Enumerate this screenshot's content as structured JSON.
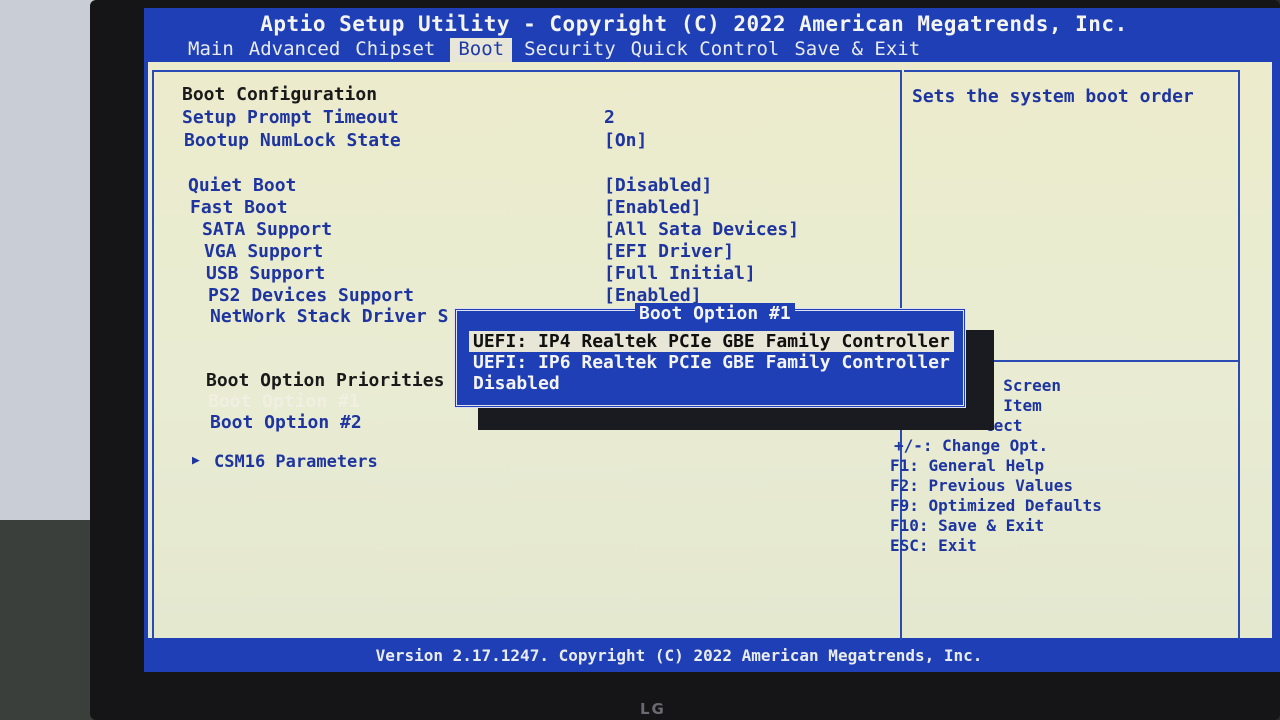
{
  "header": {
    "title": "Aptio Setup Utility - Copyright (C) 2022 American Megatrends, Inc.",
    "tabs": [
      "Main",
      "Advanced",
      "Chipset",
      "Boot",
      "Security",
      "Quick Control",
      "Save & Exit"
    ],
    "active_tab": "Boot"
  },
  "settings": {
    "section_title": "Boot Configuration",
    "setup_prompt_timeout": {
      "label": "Setup Prompt Timeout",
      "value": "2"
    },
    "bootup_numlock": {
      "label": "Bootup NumLock State",
      "value": "[On]"
    },
    "quiet_boot": {
      "label": "Quiet Boot",
      "value": "[Disabled]"
    },
    "fast_boot": {
      "label": "Fast Boot",
      "value": "[Enabled]"
    },
    "sata_support": {
      "label": "SATA Support",
      "value": "[All Sata Devices]"
    },
    "vga_support": {
      "label": "VGA Support",
      "value": "[EFI Driver]"
    },
    "usb_support": {
      "label": "USB Support",
      "value": "[Full Initial]"
    },
    "ps2_support": {
      "label": "PS2 Devices Support",
      "value": "[Enabled]"
    },
    "network_stack": {
      "label": "NetWork Stack Driver S"
    },
    "priorities_title": "Boot Option Priorities",
    "boot_option_1": {
      "label": "Boot Option #1"
    },
    "boot_option_2": {
      "label": "Boot Option #2"
    },
    "csm16": {
      "label": "CSM16 Parameters"
    }
  },
  "help": {
    "description": "Sets the system boot order",
    "keys": [
      "t Screen",
      "t Item",
      "lect",
      "+/-: Change Opt.",
      "F1: General Help",
      "F2: Previous Values",
      "F9: Optimized Defaults",
      "F10: Save & Exit",
      "ESC: Exit"
    ]
  },
  "popup": {
    "title": "Boot Option #1",
    "options": [
      "UEFI: IP4 Realtek PCIe GBE Family Controller",
      "UEFI: IP6 Realtek PCIe GBE Family Controller",
      "Disabled"
    ],
    "selected": "UEFI: IP4 Realtek PCIe GBE Family Controller"
  },
  "footer": {
    "version": "Version 2.17.1247. Copyright (C) 2022 American Megatrends, Inc."
  },
  "monitor": {
    "brand": "LG"
  },
  "colors": {
    "bios_blue": "#1f3fb7",
    "panel_bg": "#ecebcc",
    "text_blue": "#1e35a0",
    "highlight": "#e8e6d6"
  }
}
